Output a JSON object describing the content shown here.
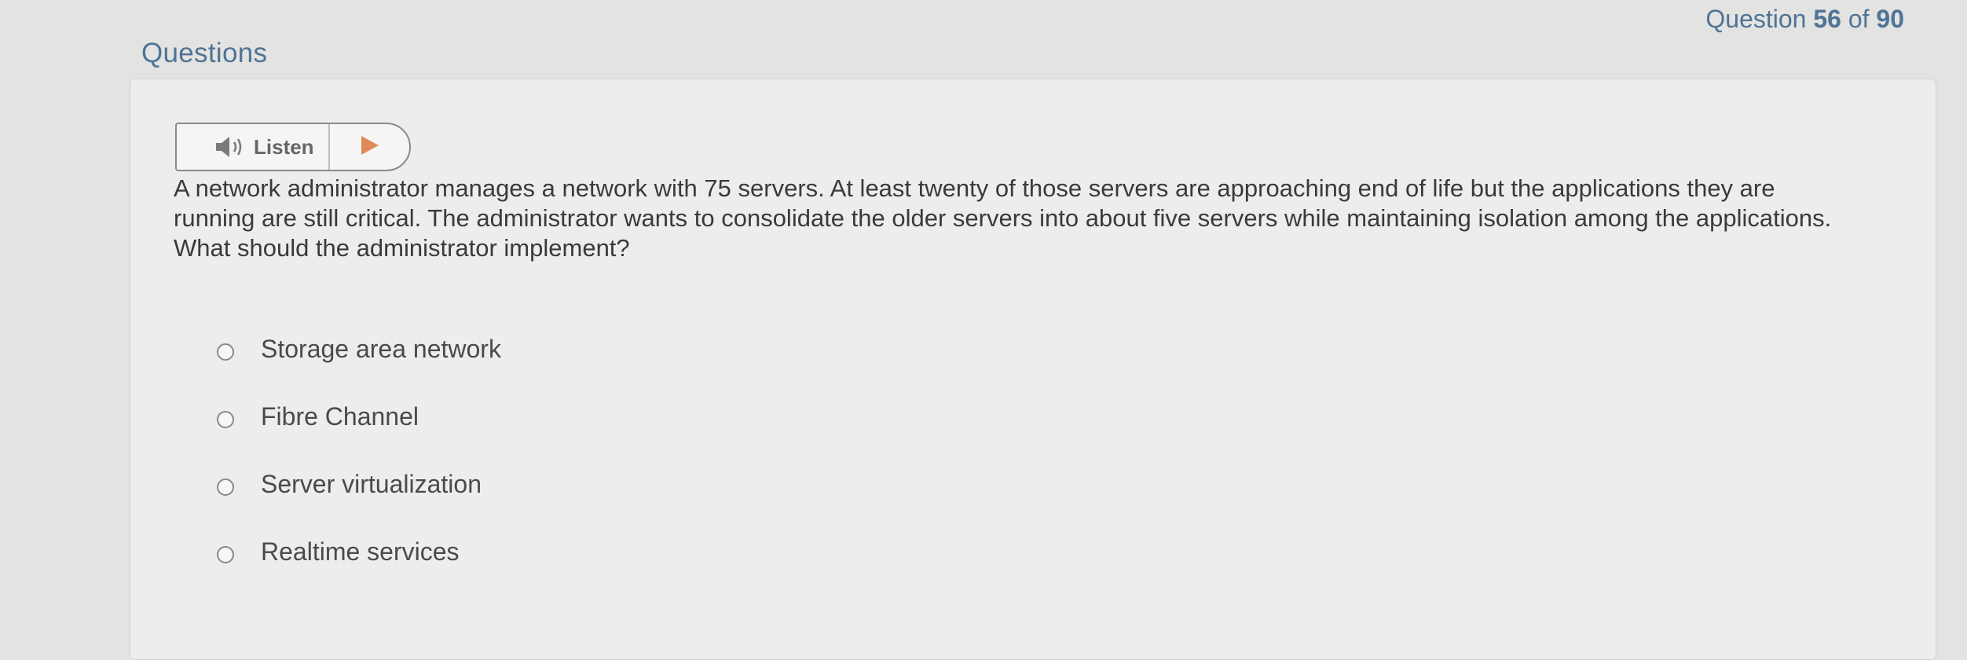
{
  "header": {
    "section_title": "Questions",
    "counter_prefix": "Question",
    "current": "56",
    "counter_of": "of",
    "total": "90"
  },
  "listen": {
    "label": "Listen",
    "icon": "speaker-icon",
    "play_icon": "play-icon"
  },
  "question": {
    "text": "A network administrator manages a network with 75 servers. At least twenty of those servers are approaching end of life but the applications they are running are still critical. The administrator wants to consolidate the older servers into about five servers while maintaining isolation among the applications. What should the administrator implement?"
  },
  "options": [
    {
      "label": "Storage area network"
    },
    {
      "label": "Fibre Channel"
    },
    {
      "label": "Server virtualization"
    },
    {
      "label": "Realtime services"
    }
  ],
  "colors": {
    "accent": "#4f7496",
    "play": "#e08a5a"
  }
}
